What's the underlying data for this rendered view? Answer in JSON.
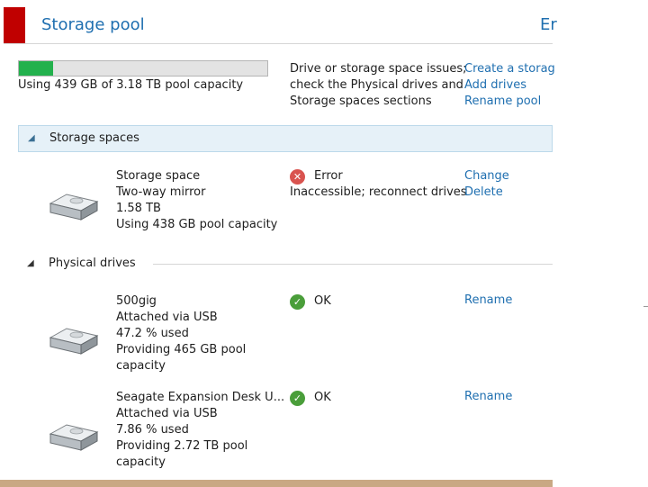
{
  "header": {
    "title": "Storage pool",
    "right_text": "Er"
  },
  "capacity": {
    "used_fraction": 0.138,
    "text": "Using 439 GB of 3.18 TB pool capacity"
  },
  "issues": {
    "lines": [
      "Drive or storage space issues;",
      "check the Physical drives and",
      "Storage spaces sections"
    ]
  },
  "pool_actions": [
    "Create a storag",
    "Add drives",
    "Rename pool"
  ],
  "storage_spaces": {
    "title": "Storage spaces",
    "items": [
      {
        "lines": [
          "Storage space",
          "Two-way mirror",
          "1.58 TB",
          "Using 438 GB pool capacity"
        ],
        "status": "Error",
        "status_detail": "Inaccessible; reconnect drives",
        "actions": [
          "Change",
          "Delete"
        ]
      }
    ]
  },
  "physical_drives": {
    "title": "Physical drives",
    "items": [
      {
        "lines": [
          "500gig",
          "Attached via USB",
          "47.2 % used",
          "Providing 465 GB pool",
          "capacity"
        ],
        "status": "OK",
        "action": "Rename"
      },
      {
        "lines": [
          "Seagate Expansion Desk U...",
          "Attached via USB",
          "7.86 % used",
          "Providing 2.72 TB pool",
          "capacity"
        ],
        "status": "OK",
        "action": "Rename"
      }
    ]
  },
  "colors": {
    "accent": "#c00000",
    "link": "#1f6fb0",
    "capacity_fill": "#23b14d",
    "ok": "#4a9e3a",
    "error": "#d9534f"
  }
}
